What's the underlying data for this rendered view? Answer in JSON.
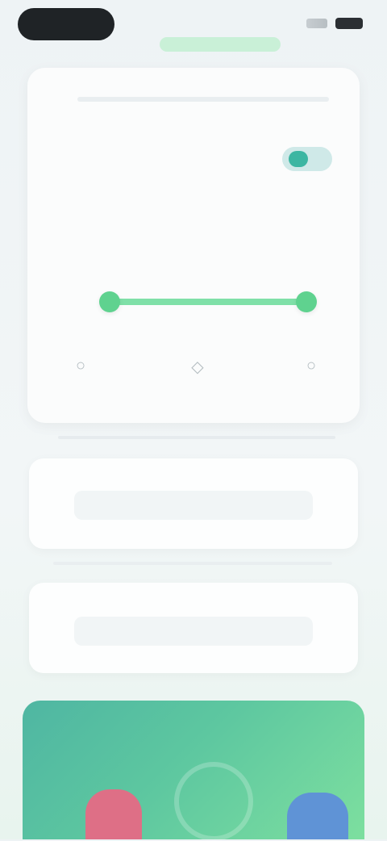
{
  "status_bar": {
    "time": "",
    "pill": ""
  },
  "card": {
    "title": "",
    "row": {
      "label": "",
      "description": ""
    },
    "range": {
      "start_label": "",
      "end_label": "",
      "start_value": "",
      "end_value": ""
    },
    "icons": [
      {
        "name": "left-action-icon",
        "glyph": "○",
        "caption": ""
      },
      {
        "name": "center-action-icon",
        "glyph": "◇",
        "caption": ""
      },
      {
        "name": "right-action-icon",
        "glyph": "○",
        "caption": ""
      }
    ]
  },
  "panel_a": {
    "field_text": ""
  },
  "panel_b": {
    "field_text": ""
  },
  "colors": {
    "accent_green": "#5fd28f",
    "toggle_teal": "#3cb6a2",
    "promo_pink": "#de6f86",
    "promo_blue": "#5f93d6"
  }
}
